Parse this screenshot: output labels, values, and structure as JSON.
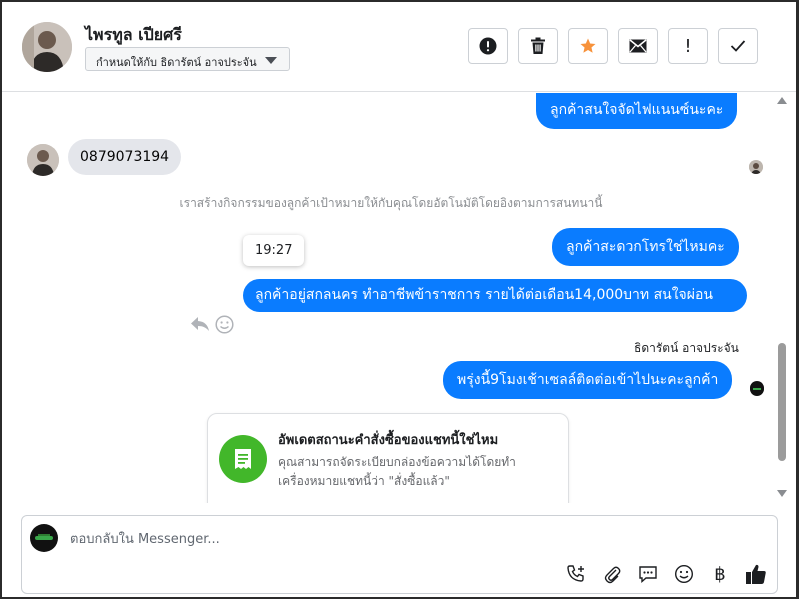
{
  "header": {
    "contact_name": "ไพรทูล เปียศรี",
    "assigned_to": "กำหนดให้กับ ธิดารัตน์ อาจประจัน",
    "actions": [
      {
        "name": "report-button",
        "icon": "exclamation-circle-icon"
      },
      {
        "name": "delete-button",
        "icon": "trash-icon"
      },
      {
        "name": "star-button",
        "icon": "star-icon",
        "color": "#f7923b"
      },
      {
        "name": "mail-button",
        "icon": "envelope-icon"
      },
      {
        "name": "mark-important-button",
        "icon": "exclamation-icon",
        "label": "!"
      },
      {
        "name": "mark-done-button",
        "icon": "checkmark-icon"
      }
    ]
  },
  "messages": {
    "out_1": "ลูกค้าสนใจจัดไฟแนนซ์นะคะ",
    "in_1": "0879073194",
    "system": "เราสร้างกิจกรรมของลูกค้าเป้าหมายให้กับคุณโดยอัตโนมัติโดยอิงตามการสนทนานี้",
    "timestamp": "19:27",
    "out_2": "ลูกค้าสะดวกโทรใช่ไหมคะ",
    "out_3": "ลูกค้าอยู่สกลนคร ทำอาชีพข้าราชการ รายได้ต่อเดือน14,000บาท สนใจผ่อน",
    "sender": "ธิดารัตน์ อาจประจัน",
    "out_4": "พรุ่งนี้9โมงเช้าเซลล์ติดต่อเข้าไปนะคะลูกค้า"
  },
  "card": {
    "title": "อัพเดตสถานะคำสั่งซื้อของแชทนี้ใช่ไหม",
    "body": "คุณสามารถจัดระเบียบกล่องข้อความได้โดยทำเครื่องหมายแชทนี้ว่า \"สั่งซื้อแล้ว\""
  },
  "composer": {
    "placeholder": "ตอบกลับใน Messenger...",
    "value": "",
    "tools": [
      "phone-plus-icon",
      "paperclip-icon",
      "saved-reply-icon",
      "emoji-icon",
      "baht-icon",
      "thumbs-up-icon"
    ],
    "baht_symbol": "฿"
  },
  "colors": {
    "accent": "#0a7cff",
    "incoming": "#e4e6eb",
    "card_icon": "#42b72a"
  }
}
